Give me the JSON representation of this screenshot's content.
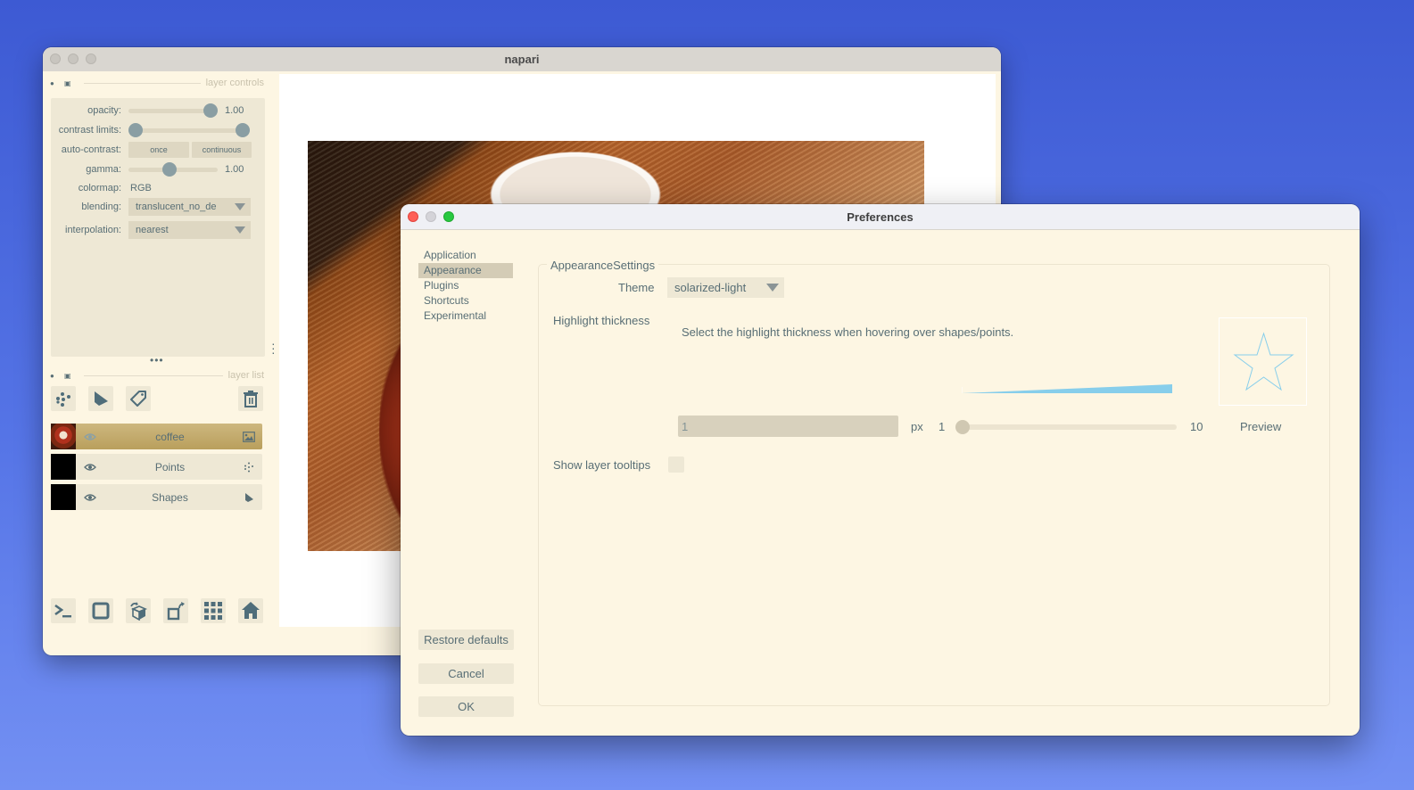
{
  "napari": {
    "window_title": "napari",
    "layer_controls": {
      "header": "layer controls",
      "opacity": {
        "label": "opacity:",
        "value": "1.00",
        "fraction": 1.0
      },
      "contrast_limits": {
        "label": "contrast limits:",
        "low_fraction": 0.0,
        "high_fraction": 1.0
      },
      "auto_contrast": {
        "label": "auto-contrast:",
        "once": "once",
        "continuous": "continuous"
      },
      "gamma": {
        "label": "gamma:",
        "value": "1.00",
        "fraction": 0.45
      },
      "colormap": {
        "label": "colormap:",
        "value": "RGB"
      },
      "blending": {
        "label": "blending:",
        "value": "translucent_no_de"
      },
      "interpolation": {
        "label": "interpolation:",
        "value": "nearest"
      }
    },
    "layer_list": {
      "header": "layer list",
      "tools": [
        "new-points-icon",
        "new-shapes-icon",
        "new-labels-icon",
        "delete-layer-icon"
      ],
      "layers": [
        {
          "name": "coffee",
          "type": "image",
          "visible": true,
          "selected": true
        },
        {
          "name": "Points",
          "type": "points",
          "visible": true,
          "selected": false
        },
        {
          "name": "Shapes",
          "type": "shapes",
          "visible": true,
          "selected": false
        }
      ]
    },
    "bottom_tools": [
      "console-icon",
      "ndisplay-square-icon",
      "roll-dims-icon",
      "transpose-icon",
      "grid-icon",
      "home-icon"
    ]
  },
  "preferences": {
    "title": "Preferences",
    "nav": [
      {
        "label": "Application",
        "active": false
      },
      {
        "label": "Appearance",
        "active": true
      },
      {
        "label": "Plugins",
        "active": false
      },
      {
        "label": "Shortcuts",
        "active": false
      },
      {
        "label": "Experimental",
        "active": false
      }
    ],
    "buttons": {
      "restore": "Restore defaults",
      "cancel": "Cancel",
      "ok": "OK"
    },
    "group_title": "AppearanceSettings",
    "theme": {
      "label": "Theme",
      "value": "solarized-light"
    },
    "highlight": {
      "label": "Highlight thickness",
      "description": "Select the highlight thickness when hovering over shapes/points.",
      "value": "1",
      "unit": "px",
      "min": "1",
      "max": "10",
      "slider_fraction": 0.0,
      "preview_label": "Preview"
    },
    "tooltips": {
      "label": "Show layer tooltips",
      "checked": false
    },
    "accent_color": "#87ceeb"
  }
}
